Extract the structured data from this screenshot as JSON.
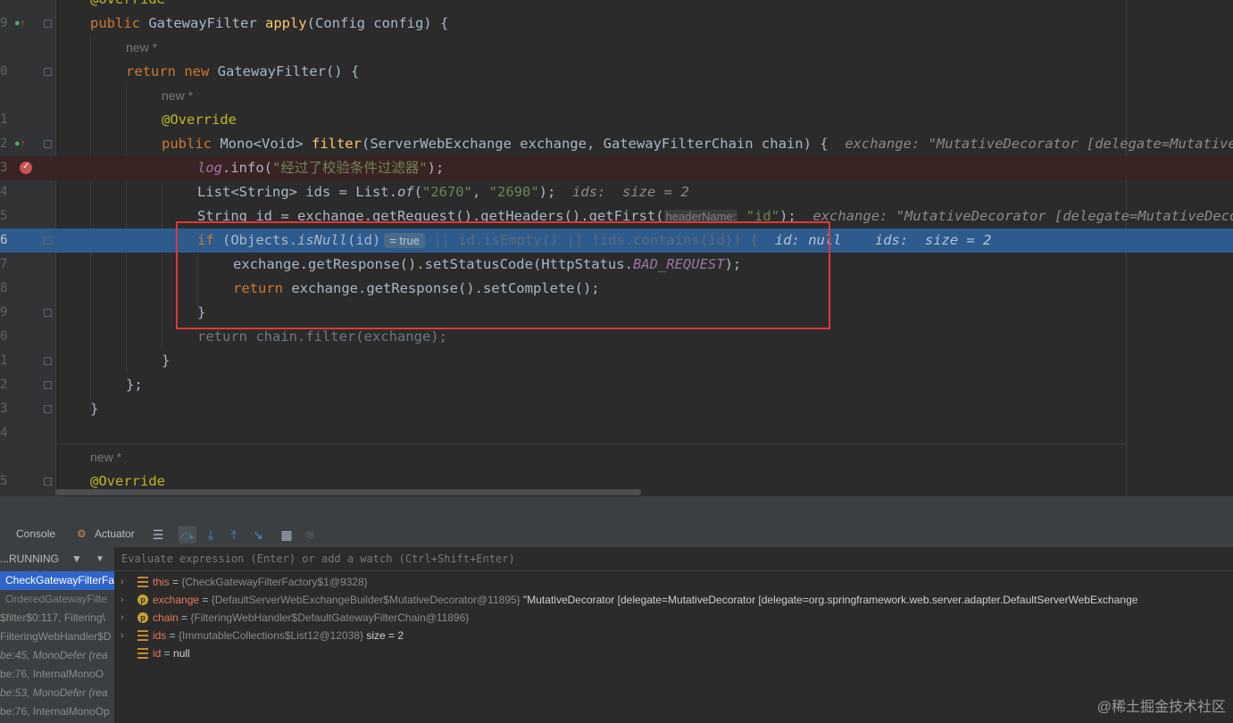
{
  "editor": {
    "lines": [
      {
        "n": "",
        "top": 0
      },
      {
        "n": "9"
      },
      {
        "n": ""
      },
      {
        "n": "0"
      },
      {
        "n": ""
      },
      {
        "n": "1"
      },
      {
        "n": "2"
      },
      {
        "n": "3"
      },
      {
        "n": "4"
      },
      {
        "n": "5"
      },
      {
        "n": "6"
      },
      {
        "n": "7"
      },
      {
        "n": "8"
      },
      {
        "n": "9"
      },
      {
        "n": "0"
      },
      {
        "n": "1"
      },
      {
        "n": "2"
      },
      {
        "n": "3"
      },
      {
        "n": "4"
      },
      {
        "n": ""
      },
      {
        "n": "5"
      }
    ],
    "t": {
      "override1": "@Override",
      "public1": "public",
      "type1": " GatewayFilter ",
      "apply": "apply",
      "apply_args": "(Config config) {",
      "new1": "new *",
      "return1": "return new",
      "gf_new": " GatewayFilter() {",
      "new2": "new *",
      "override2": "@Override",
      "public2": "public",
      "mono": " Mono<Void> ",
      "filter": "filter",
      "filter_args": "(ServerWebExchange exchange, GatewayFilterChain chain) {",
      "hint_exchange1": "exchange: \"MutativeDecorator [delegate=MutativeDecorator",
      "log": "log",
      "info_open": ".info(",
      "log_str": "\"经过了校验条件过滤器\"",
      "info_close": ");",
      "list_decl": "List<String> ids = List.",
      "of": "of",
      "of_open": "(",
      "s2670": "\"2670\"",
      "comma": ", ",
      "s2690": "\"2690\"",
      "of_close": ");",
      "hint_ids": "ids:  size = 2",
      "string_decl": "String id = exchange.getRequest().getHeaders().getFirst(",
      "param_name": "headerName:",
      "sid": " \"id\"",
      "getfirst_close": ");",
      "hint_exchange2": "exchange: \"MutativeDecorator [delegate=MutativeDecorator",
      "if": "if",
      "if_open": " (Objects.",
      "isnull": "isNull",
      "isnull_args": "(id)",
      "true_badge": "= true",
      "if_rest": " || id.isEmpty() || !ids.contains(id)) {",
      "hint_id": "id: null    ids:  size = 2",
      "status_line": "exchange.getResponse().setStatusCode(HttpStatus.",
      "bad_request": "BAD_REQUEST",
      "status_close": ");",
      "return2": "return",
      "complete": " exchange.getResponse().setComplete();",
      "close_brace1": "}",
      "return3": "return chain.filter(exchange);",
      "close_brace2": "}",
      "close_brace3": "};",
      "close_brace4": "}",
      "new3": "new *",
      "override3": "@Override"
    }
  },
  "toolbar": {
    "console": "Console",
    "actuator": "Actuator"
  },
  "frames": {
    "header": "...RUNNING",
    "items": [
      "CheckGatewayFilterFa",
      "OrderedGatewayFilte",
      "$filter$0:117, Filtering\\",
      "FilteringWebHandler$D",
      "be:45, MonoDefer (rea",
      "be:76, InternalMonoO",
      "be:53, MonoDefer (rea",
      "be:76, InternalMonoOp"
    ]
  },
  "eval": {
    "placeholder": "Evaluate expression (Enter) or add a watch (Ctrl+Shift+Enter)"
  },
  "variables": [
    {
      "name": "this",
      "eq": " = ",
      "type": "{CheckGatewayFilterFactory$1@9328}",
      "val": "",
      "icon": "list",
      "expand": true
    },
    {
      "name": "exchange",
      "eq": " = ",
      "type": "{DefaultServerWebExchangeBuilder$MutativeDecorator@11895}",
      "val": " \"MutativeDecorator [delegate=MutativeDecorator [delegate=org.springframework.web.server.adapter.DefaultServerWebExchange",
      "icon": "p",
      "expand": true
    },
    {
      "name": "chain",
      "eq": " = ",
      "type": "{FilteringWebHandler$DefaultGatewayFilterChain@11896}",
      "val": "",
      "icon": "p",
      "expand": true
    },
    {
      "name": "ids",
      "eq": " = ",
      "type": "{ImmutableCollections$List12@12038}",
      "val": "  size = 2",
      "icon": "list",
      "expand": true
    },
    {
      "name": "id",
      "eq": " = ",
      "type": "",
      "val": "null",
      "icon": "list",
      "expand": false
    }
  ],
  "watermark": "@稀土掘金技术社区"
}
